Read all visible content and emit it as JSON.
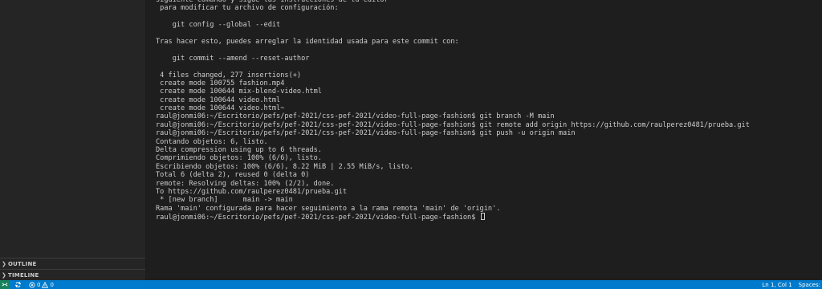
{
  "sidebar": {
    "sections": [
      {
        "label": "OUTLINE"
      },
      {
        "label": "TIMELINE"
      }
    ]
  },
  "terminal": {
    "lines": [
      "siguiente comando y sigue las instrucciones de tu editor",
      " para modificar tu archivo de configuración:",
      "",
      "    git config --global --edit",
      "",
      "Tras hacer esto, puedes arreglar la identidad usada para este commit con:",
      "",
      "    git commit --amend --reset-author",
      "",
      " 4 files changed, 277 insertions(+)",
      " create mode 100755 fashion.mp4",
      " create mode 100644 mix-blend-video.html",
      " create mode 100644 video.html",
      " create mode 100644 video.html~",
      "raul@jonmi06:~/Escritorio/pefs/pef-2021/css-pef-2021/video-full-page-fashion$ git branch -M main",
      "raul@jonmi06:~/Escritorio/pefs/pef-2021/css-pef-2021/video-full-page-fashion$ git remote add origin https://github.com/raulperez0481/prueba.git",
      "raul@jonmi06:~/Escritorio/pefs/pef-2021/css-pef-2021/video-full-page-fashion$ git push -u origin main",
      "Contando objetos: 6, listo.",
      "Delta compression using up to 6 threads.",
      "Comprimiendo objetos: 100% (6/6), listo.",
      "Escribiendo objetos: 100% (6/6), 8.22 MiB | 2.55 MiB/s, listo.",
      "Total 6 (delta 2), reused 0 (delta 0)",
      "remote: Resolving deltas: 100% (2/2), done.",
      "To https://github.com/raulperez0481/prueba.git",
      " * [new branch]      main -> main",
      "Rama 'main' configurada para hacer seguimiento a la rama remota 'main' de 'origin'."
    ],
    "prompt": "raul@jonmi06:~/Escritorio/pefs/pef-2021/css-pef-2021/video-full-page-fashion$ "
  },
  "statusbar": {
    "remote_icon": "remote-icon",
    "sync_icon": "sync-icon",
    "errors": "0",
    "warnings": "0",
    "position": "Ln 1, Col 1",
    "spaces": "Spaces:"
  },
  "colors": {
    "statusbar": "#007acc",
    "terminal_bg": "#1e1e1e",
    "sidebar_bg": "#252526",
    "text": "#cccccc"
  }
}
